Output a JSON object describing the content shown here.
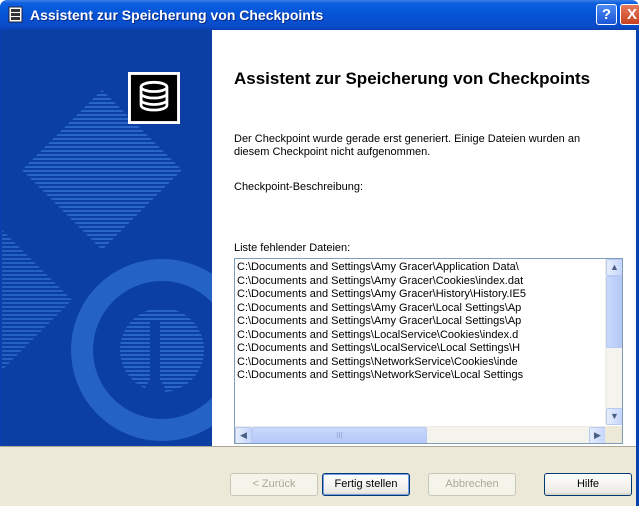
{
  "window": {
    "title": "Assistent zur Speicherung von Checkpoints",
    "help_glyph": "?",
    "close_glyph": "X"
  },
  "main": {
    "heading": "Assistent zur Speicherung von Checkpoints",
    "description": "Der Checkpoint wurde gerade erst generiert. Einige Dateien wurden an diesem Checkpoint nicht aufgenommen.",
    "checkpoint_label": "Checkpoint-Beschreibung:",
    "missing_files_label": "Liste fehlender Dateien:",
    "missing_files": [
      "C:\\Documents and Settings\\Amy Gracer\\Application Data\\",
      "C:\\Documents and Settings\\Amy Gracer\\Cookies\\index.dat",
      "C:\\Documents and Settings\\Amy Gracer\\History\\History.IE5",
      "C:\\Documents and Settings\\Amy Gracer\\Local Settings\\Ap",
      "C:\\Documents and Settings\\Amy Gracer\\Local Settings\\Ap",
      "C:\\Documents and Settings\\LocalService\\Cookies\\index.d",
      "C:\\Documents and Settings\\LocalService\\Local Settings\\H",
      "C:\\Documents and Settings\\NetworkService\\Cookies\\inde",
      "C:\\Documents and Settings\\NetworkService\\Local Settings"
    ]
  },
  "footer": {
    "back_label": "< Zurück",
    "finish_label": "Fertig stellen",
    "cancel_label": "Abbrechen",
    "help_label": "Hilfe"
  },
  "colors": {
    "titlebar": "#0553d6",
    "banner": "#0b3fa3",
    "footer": "#ece9d8"
  },
  "icons": {
    "title": "disk-stack-icon",
    "logo": "database-icon"
  }
}
